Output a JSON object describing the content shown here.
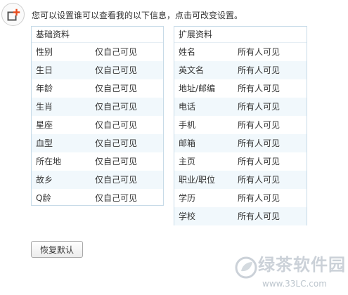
{
  "intro_text": "您可以设置谁可以查看我的以下信息，点击可改变设置。",
  "basic": {
    "title": "基础资料",
    "rows": [
      {
        "field": "性别",
        "visibility": "仅自己可见"
      },
      {
        "field": "生日",
        "visibility": "仅自己可见"
      },
      {
        "field": "年龄",
        "visibility": "仅自己可见"
      },
      {
        "field": "生肖",
        "visibility": "仅自己可见"
      },
      {
        "field": "星座",
        "visibility": "仅自己可见"
      },
      {
        "field": "血型",
        "visibility": "仅自己可见"
      },
      {
        "field": "所在地",
        "visibility": "仅自己可见"
      },
      {
        "field": "故乡",
        "visibility": "仅自己可见"
      },
      {
        "field": "Q龄",
        "visibility": "仅自己可见"
      }
    ]
  },
  "extended": {
    "title": "扩展资料",
    "rows": [
      {
        "field": "姓名",
        "visibility": "所有人可见"
      },
      {
        "field": "英文名",
        "visibility": "所有人可见"
      },
      {
        "field": "地址/邮编",
        "visibility": "所有人可见"
      },
      {
        "field": "电话",
        "visibility": "所有人可见"
      },
      {
        "field": "手机",
        "visibility": "所有人可见"
      },
      {
        "field": "邮箱",
        "visibility": "所有人可见"
      },
      {
        "field": "主页",
        "visibility": "所有人可见"
      },
      {
        "field": "职业/职位",
        "visibility": "所有人可见"
      },
      {
        "field": "学历",
        "visibility": "所有人可见"
      },
      {
        "field": "学校",
        "visibility": "所有人可见"
      }
    ]
  },
  "restore_label": "恢复默认",
  "watermark": {
    "brand": "绿茶软件园",
    "url": "www.33LC.com"
  },
  "icons": {
    "top_icon": "profile-add-icon",
    "watermark_logo": "leaf-logo-icon"
  },
  "colors": {
    "icon_accent": "#e84c1e",
    "panel_border": "#c7dbe8",
    "row_stripe": "#f1f8fc"
  }
}
